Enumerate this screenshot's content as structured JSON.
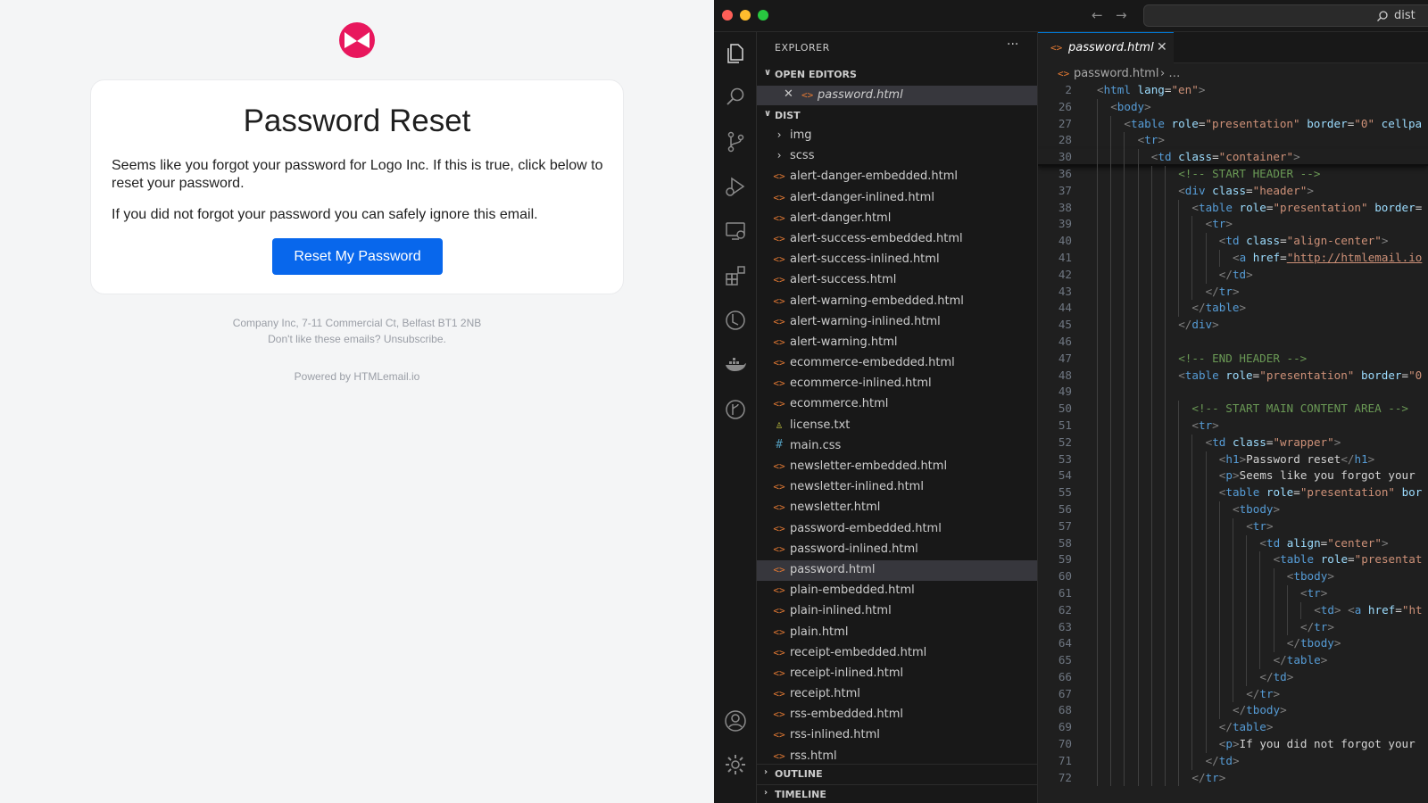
{
  "email": {
    "title": "Password Reset",
    "paragraph_1": "Seems like you forgot your password for Logo Inc. If this is true, click below to reset your password.",
    "paragraph_2": "If you did not forgot your password you can safely ignore this email.",
    "button_label": "Reset My Password",
    "footer_address": "Company Inc, 7-11 Commercial Ct, Belfast BT1 2NB",
    "footer_unsubscribe": "Don't like these emails? Unsubscribe.",
    "footer_powered": "Powered by HTMLemail.io",
    "colors": {
      "button": "#0867ec",
      "logo": "#e8175d"
    }
  },
  "window": {
    "command_center_text": "dist"
  },
  "activity_bar": {
    "icons": [
      "files-icon",
      "search-icon",
      "source-control-icon",
      "run-debug-icon",
      "remote-explorer-icon",
      "extensions-icon",
      "testing-icon",
      "docker-icon",
      "git-graph-icon",
      "accounts-icon",
      "settings-gear-icon"
    ]
  },
  "sidebar": {
    "title": "EXPLORER",
    "more_label": "···",
    "open_editors_label": "OPEN EDITORS",
    "open_editor_file": "password.html",
    "dist_label": "DIST",
    "files": [
      {
        "name": "img",
        "kind": "folder"
      },
      {
        "name": "scss",
        "kind": "folder"
      },
      {
        "name": "alert-danger-embedded.html",
        "kind": "html"
      },
      {
        "name": "alert-danger-inlined.html",
        "kind": "html"
      },
      {
        "name": "alert-danger.html",
        "kind": "html"
      },
      {
        "name": "alert-success-embedded.html",
        "kind": "html"
      },
      {
        "name": "alert-success-inlined.html",
        "kind": "html"
      },
      {
        "name": "alert-success.html",
        "kind": "html"
      },
      {
        "name": "alert-warning-embedded.html",
        "kind": "html"
      },
      {
        "name": "alert-warning-inlined.html",
        "kind": "html"
      },
      {
        "name": "alert-warning.html",
        "kind": "html"
      },
      {
        "name": "ecommerce-embedded.html",
        "kind": "html"
      },
      {
        "name": "ecommerce-inlined.html",
        "kind": "html"
      },
      {
        "name": "ecommerce.html",
        "kind": "html"
      },
      {
        "name": "license.txt",
        "kind": "txt"
      },
      {
        "name": "main.css",
        "kind": "css"
      },
      {
        "name": "newsletter-embedded.html",
        "kind": "html"
      },
      {
        "name": "newsletter-inlined.html",
        "kind": "html"
      },
      {
        "name": "newsletter.html",
        "kind": "html"
      },
      {
        "name": "password-embedded.html",
        "kind": "html"
      },
      {
        "name": "password-inlined.html",
        "kind": "html"
      },
      {
        "name": "password.html",
        "kind": "html",
        "selected": true
      },
      {
        "name": "plain-embedded.html",
        "kind": "html"
      },
      {
        "name": "plain-inlined.html",
        "kind": "html"
      },
      {
        "name": "plain.html",
        "kind": "html"
      },
      {
        "name": "receipt-embedded.html",
        "kind": "html"
      },
      {
        "name": "receipt-inlined.html",
        "kind": "html"
      },
      {
        "name": "receipt.html",
        "kind": "html"
      },
      {
        "name": "rss-embedded.html",
        "kind": "html"
      },
      {
        "name": "rss-inlined.html",
        "kind": "html"
      },
      {
        "name": "rss.html",
        "kind": "html"
      }
    ],
    "outline_label": "OUTLINE",
    "timeline_label": "TIMELINE"
  },
  "editor": {
    "tab_label": "password.html",
    "breadcrumb_file": "password.html",
    "breadcrumb_rest": "…",
    "lines": [
      {
        "n": "2",
        "g": 0,
        "seg": [
          [
            "p",
            "<"
          ],
          [
            "t",
            "html"
          ],
          [
            "x",
            " "
          ],
          [
            "a",
            "lang"
          ],
          [
            "x",
            "="
          ],
          [
            "s",
            "\"en\""
          ],
          [
            "p",
            ">"
          ]
        ]
      },
      {
        "n": "26",
        "g": 1,
        "seg": [
          [
            "p",
            "<"
          ],
          [
            "t",
            "body"
          ],
          [
            "p",
            ">"
          ]
        ]
      },
      {
        "n": "27",
        "g": 2,
        "seg": [
          [
            "p",
            "<"
          ],
          [
            "t",
            "table"
          ],
          [
            "x",
            " "
          ],
          [
            "a",
            "role"
          ],
          [
            "x",
            "="
          ],
          [
            "s",
            "\"presentation\""
          ],
          [
            "x",
            " "
          ],
          [
            "a",
            "border"
          ],
          [
            "x",
            "="
          ],
          [
            "s",
            "\"0\""
          ],
          [
            "x",
            " "
          ],
          [
            "a",
            "cellpa"
          ]
        ]
      },
      {
        "n": "28",
        "g": 3,
        "seg": [
          [
            "p",
            "<"
          ],
          [
            "t",
            "tr"
          ],
          [
            "p",
            ">"
          ]
        ]
      },
      {
        "n": "30",
        "g": 4,
        "seg": [
          [
            "p",
            "<"
          ],
          [
            "t",
            "td"
          ],
          [
            "x",
            " "
          ],
          [
            "a",
            "class"
          ],
          [
            "x",
            "="
          ],
          [
            "s",
            "\"container\""
          ],
          [
            "p",
            ">"
          ]
        ],
        "stick_end": true
      },
      {
        "n": "36",
        "g": 6,
        "seg": [
          [
            "c",
            "<!-- START HEADER -->"
          ]
        ]
      },
      {
        "n": "37",
        "g": 6,
        "seg": [
          [
            "p",
            "<"
          ],
          [
            "t",
            "div"
          ],
          [
            "x",
            " "
          ],
          [
            "a",
            "class"
          ],
          [
            "x",
            "="
          ],
          [
            "s",
            "\"header\""
          ],
          [
            "p",
            ">"
          ]
        ]
      },
      {
        "n": "38",
        "g": 7,
        "seg": [
          [
            "p",
            "<"
          ],
          [
            "t",
            "table"
          ],
          [
            "x",
            " "
          ],
          [
            "a",
            "role"
          ],
          [
            "x",
            "="
          ],
          [
            "s",
            "\"presentation\""
          ],
          [
            "x",
            " "
          ],
          [
            "a",
            "border"
          ],
          [
            "x",
            "="
          ]
        ]
      },
      {
        "n": "39",
        "g": 8,
        "seg": [
          [
            "p",
            "<"
          ],
          [
            "t",
            "tr"
          ],
          [
            "p",
            ">"
          ]
        ]
      },
      {
        "n": "40",
        "g": 9,
        "seg": [
          [
            "p",
            "<"
          ],
          [
            "t",
            "td"
          ],
          [
            "x",
            " "
          ],
          [
            "a",
            "class"
          ],
          [
            "x",
            "="
          ],
          [
            "s",
            "\"align-center\""
          ],
          [
            "p",
            ">"
          ]
        ]
      },
      {
        "n": "41",
        "g": 10,
        "seg": [
          [
            "p",
            "<"
          ],
          [
            "t",
            "a"
          ],
          [
            "x",
            " "
          ],
          [
            "a",
            "href"
          ],
          [
            "x",
            "="
          ],
          [
            "u",
            "\"http://htmlemail.io"
          ]
        ]
      },
      {
        "n": "42",
        "g": 9,
        "seg": [
          [
            "p",
            "</"
          ],
          [
            "t",
            "td"
          ],
          [
            "p",
            ">"
          ]
        ]
      },
      {
        "n": "43",
        "g": 8,
        "seg": [
          [
            "p",
            "</"
          ],
          [
            "t",
            "tr"
          ],
          [
            "p",
            ">"
          ]
        ]
      },
      {
        "n": "44",
        "g": 7,
        "seg": [
          [
            "p",
            "</"
          ],
          [
            "t",
            "table"
          ],
          [
            "p",
            ">"
          ]
        ]
      },
      {
        "n": "45",
        "g": 6,
        "seg": [
          [
            "p",
            "</"
          ],
          [
            "t",
            "div"
          ],
          [
            "p",
            ">"
          ]
        ]
      },
      {
        "n": "46",
        "g": 6,
        "seg": []
      },
      {
        "n": "47",
        "g": 6,
        "seg": [
          [
            "c",
            "<!-- END HEADER -->"
          ]
        ]
      },
      {
        "n": "48",
        "g": 6,
        "seg": [
          [
            "p",
            "<"
          ],
          [
            "t",
            "table"
          ],
          [
            "x",
            " "
          ],
          [
            "a",
            "role"
          ],
          [
            "x",
            "="
          ],
          [
            "s",
            "\"presentation\""
          ],
          [
            "x",
            " "
          ],
          [
            "a",
            "border"
          ],
          [
            "x",
            "="
          ],
          [
            "s",
            "\"0"
          ]
        ]
      },
      {
        "n": "49",
        "g": 6,
        "seg": []
      },
      {
        "n": "50",
        "g": 7,
        "seg": [
          [
            "c",
            "<!-- START MAIN CONTENT AREA -->"
          ]
        ]
      },
      {
        "n": "51",
        "g": 7,
        "seg": [
          [
            "p",
            "<"
          ],
          [
            "t",
            "tr"
          ],
          [
            "p",
            ">"
          ]
        ]
      },
      {
        "n": "52",
        "g": 8,
        "seg": [
          [
            "p",
            "<"
          ],
          [
            "t",
            "td"
          ],
          [
            "x",
            " "
          ],
          [
            "a",
            "class"
          ],
          [
            "x",
            "="
          ],
          [
            "s",
            "\"wrapper\""
          ],
          [
            "p",
            ">"
          ]
        ]
      },
      {
        "n": "53",
        "g": 9,
        "seg": [
          [
            "p",
            "<"
          ],
          [
            "t",
            "h1"
          ],
          [
            "p",
            ">"
          ],
          [
            "x",
            "Password reset"
          ],
          [
            "p",
            "</"
          ],
          [
            "t",
            "h1"
          ],
          [
            "p",
            ">"
          ]
        ]
      },
      {
        "n": "54",
        "g": 9,
        "seg": [
          [
            "p",
            "<"
          ],
          [
            "t",
            "p"
          ],
          [
            "p",
            ">"
          ],
          [
            "x",
            "Seems like you forgot your"
          ]
        ]
      },
      {
        "n": "55",
        "g": 9,
        "seg": [
          [
            "p",
            "<"
          ],
          [
            "t",
            "table"
          ],
          [
            "x",
            " "
          ],
          [
            "a",
            "role"
          ],
          [
            "x",
            "="
          ],
          [
            "s",
            "\"presentation\""
          ],
          [
            "x",
            " "
          ],
          [
            "a",
            "bor"
          ]
        ]
      },
      {
        "n": "56",
        "g": 10,
        "seg": [
          [
            "p",
            "<"
          ],
          [
            "t",
            "tbody"
          ],
          [
            "p",
            ">"
          ]
        ]
      },
      {
        "n": "57",
        "g": 11,
        "seg": [
          [
            "p",
            "<"
          ],
          [
            "t",
            "tr"
          ],
          [
            "p",
            ">"
          ]
        ]
      },
      {
        "n": "58",
        "g": 12,
        "seg": [
          [
            "p",
            "<"
          ],
          [
            "t",
            "td"
          ],
          [
            "x",
            " "
          ],
          [
            "a",
            "align"
          ],
          [
            "x",
            "="
          ],
          [
            "s",
            "\"center\""
          ],
          [
            "p",
            ">"
          ]
        ]
      },
      {
        "n": "59",
        "g": 13,
        "seg": [
          [
            "p",
            "<"
          ],
          [
            "t",
            "table"
          ],
          [
            "x",
            " "
          ],
          [
            "a",
            "role"
          ],
          [
            "x",
            "="
          ],
          [
            "s",
            "\"presentat"
          ]
        ]
      },
      {
        "n": "60",
        "g": 14,
        "seg": [
          [
            "p",
            "<"
          ],
          [
            "t",
            "tbody"
          ],
          [
            "p",
            ">"
          ]
        ]
      },
      {
        "n": "61",
        "g": 15,
        "seg": [
          [
            "p",
            "<"
          ],
          [
            "t",
            "tr"
          ],
          [
            "p",
            ">"
          ]
        ]
      },
      {
        "n": "62",
        "g": 16,
        "seg": [
          [
            "p",
            "<"
          ],
          [
            "t",
            "td"
          ],
          [
            "p",
            ">"
          ],
          [
            "x",
            " "
          ],
          [
            "p",
            "<"
          ],
          [
            "t",
            "a"
          ],
          [
            "x",
            " "
          ],
          [
            "a",
            "href"
          ],
          [
            "x",
            "="
          ],
          [
            "s",
            "\"ht"
          ]
        ]
      },
      {
        "n": "63",
        "g": 15,
        "seg": [
          [
            "p",
            "</"
          ],
          [
            "t",
            "tr"
          ],
          [
            "p",
            ">"
          ]
        ]
      },
      {
        "n": "64",
        "g": 14,
        "seg": [
          [
            "p",
            "</"
          ],
          [
            "t",
            "tbody"
          ],
          [
            "p",
            ">"
          ]
        ]
      },
      {
        "n": "65",
        "g": 13,
        "seg": [
          [
            "p",
            "</"
          ],
          [
            "t",
            "table"
          ],
          [
            "p",
            ">"
          ]
        ]
      },
      {
        "n": "66",
        "g": 12,
        "seg": [
          [
            "p",
            "</"
          ],
          [
            "t",
            "td"
          ],
          [
            "p",
            ">"
          ]
        ]
      },
      {
        "n": "67",
        "g": 11,
        "seg": [
          [
            "p",
            "</"
          ],
          [
            "t",
            "tr"
          ],
          [
            "p",
            ">"
          ]
        ]
      },
      {
        "n": "68",
        "g": 10,
        "seg": [
          [
            "p",
            "</"
          ],
          [
            "t",
            "tbody"
          ],
          [
            "p",
            ">"
          ]
        ]
      },
      {
        "n": "69",
        "g": 9,
        "seg": [
          [
            "p",
            "</"
          ],
          [
            "t",
            "table"
          ],
          [
            "p",
            ">"
          ]
        ]
      },
      {
        "n": "70",
        "g": 9,
        "seg": [
          [
            "p",
            "<"
          ],
          [
            "t",
            "p"
          ],
          [
            "p",
            ">"
          ],
          [
            "x",
            "If you did not forgot your"
          ]
        ]
      },
      {
        "n": "71",
        "g": 8,
        "seg": [
          [
            "p",
            "</"
          ],
          [
            "t",
            "td"
          ],
          [
            "p",
            ">"
          ]
        ]
      },
      {
        "n": "72",
        "g": 7,
        "seg": [
          [
            "p",
            "</"
          ],
          [
            "t",
            "tr"
          ],
          [
            "p",
            ">"
          ]
        ]
      }
    ]
  }
}
